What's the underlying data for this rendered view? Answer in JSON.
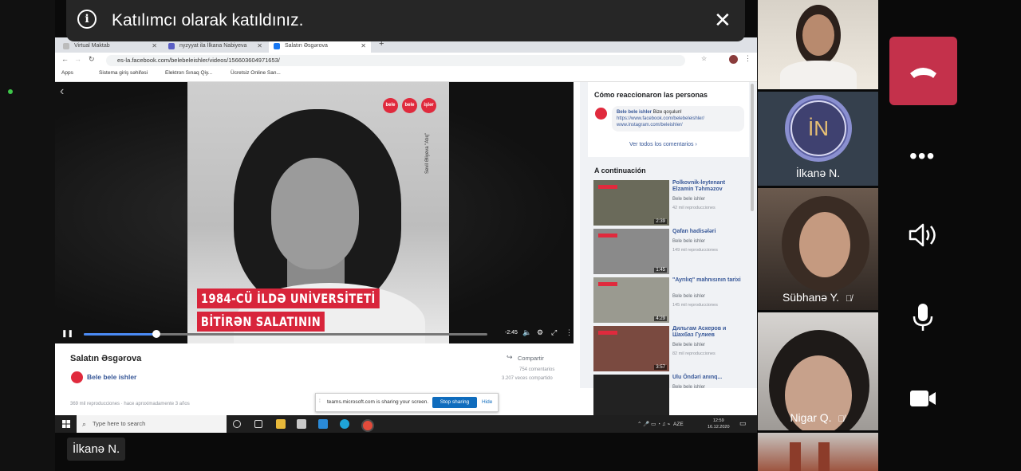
{
  "banner": {
    "message": "Katılımcı olarak katıldınız.",
    "close": "✕"
  },
  "browser": {
    "tabs": [
      {
        "label": "Virtual Maktab",
        "close": "✕"
      },
      {
        "label": "nyzyyat ila İlkana Nabiyeva",
        "close": "✕"
      },
      {
        "label": "Salatın Əsgərova",
        "close": "✕"
      }
    ],
    "new_tab": "+",
    "url": "es-la.facebook.com/belebeleishler/videos/156603604971653/",
    "bookmarks": [
      "Apps",
      "Sistema giriş səhifəsi",
      "Elektron Sınaq Qiy...",
      "Ücretsiz Online San..."
    ]
  },
  "video": {
    "logo_words": [
      "bele",
      "bele",
      "işlər"
    ],
    "photo_credit": "Sevil Əliyeva \"Atıq\"",
    "caption_line1": "1984-CÜ İLDƏ UNİVERSİTETİ",
    "caption_line2": "BİTİRƏN SALATININ",
    "time_remaining": "-2:45",
    "progress_fraction": 0.18
  },
  "post": {
    "title": "Salatın Əsgərova",
    "page_name": "Bele bele ishler",
    "share_label": "Compartir",
    "comments": "754 comentarios",
    "shares": "3.207 veces compartido",
    "views_meta": "369 mil reproducciones · hace aproximadamente 3 años"
  },
  "share_notice": {
    "text": "teams.microsoft.com is sharing your screen.",
    "stop": "Stop sharing",
    "hide": "Hide"
  },
  "right_panel": {
    "reactions_title": "Cómo reaccionaron las personas",
    "comment_author": "Bele bele ishler",
    "comment_text": "Bize qoşulun!",
    "comment_link1": "https://www.facebook.com/belebeleishler/",
    "comment_link2": "www.instagram.com/beleishler/",
    "see_all": "Ver todos los comentarios ›",
    "next_title": "A continuación",
    "related": [
      {
        "title": "Polkovnik-leytenant Elzamin Təhməzov",
        "page": "Bele bele ishler",
        "views": "42 mil reproducciones",
        "duration": "2:39",
        "color": "#6a6a5a"
      },
      {
        "title": "Qafan hadisələri",
        "page": "Bele bele ishler",
        "views": "149 mil reproducciones",
        "duration": "1:45",
        "color": "#8a8a8a"
      },
      {
        "title": "\"Ayrılıq\" mahnısının tarixi",
        "page": "Bele bele ishler",
        "views": "145 mil reproducciones",
        "duration": "4:29",
        "color": "#9a9a90"
      },
      {
        "title": "Дильгам Аскеров и Шахбаз Гулиев",
        "page": "Bele bele ishler",
        "views": "82 mil reproducciones",
        "duration": "3:57",
        "color": "#7a4a40"
      },
      {
        "title": "Ulu Öndəri anınq...",
        "page": "Bele bele ishler",
        "views": "",
        "duration": "",
        "color": "#222222"
      }
    ]
  },
  "taskbar": {
    "search_placeholder": "Type here to search",
    "lang": "AZE",
    "time": "12:59",
    "date": "16.12.2020"
  },
  "bottom_label": "İlkanə N.",
  "participants": [
    {
      "name": "",
      "muted": false
    },
    {
      "name": "İlkanə N.",
      "initials": "İN",
      "muted": false
    },
    {
      "name": "Sübhanə Y.",
      "muted": true
    },
    {
      "name": "Nigar Q.",
      "muted": true
    },
    {
      "name": "",
      "muted": false
    }
  ],
  "colors": {
    "hangup": "#c4314b",
    "facebook_link": "#385898",
    "brand_red": "#e02a3d"
  }
}
